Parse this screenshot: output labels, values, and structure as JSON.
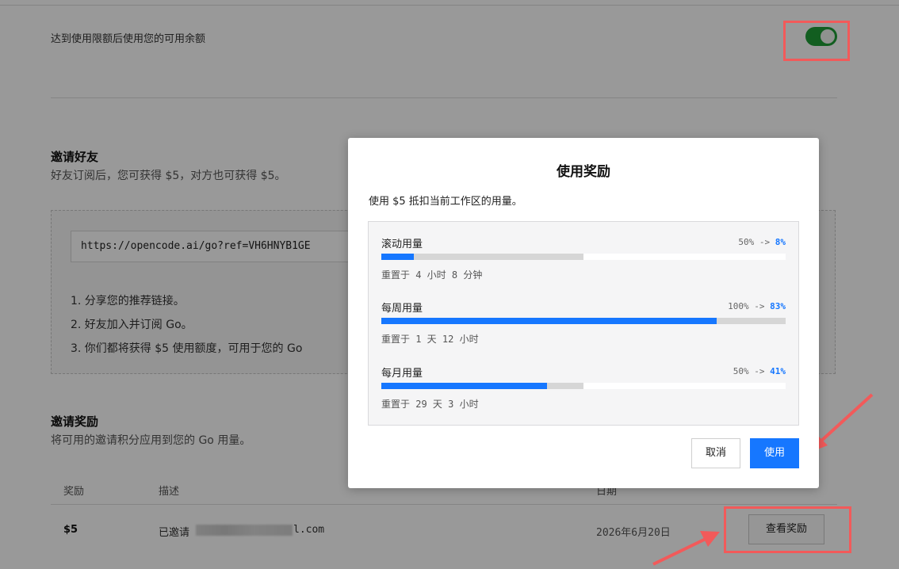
{
  "settings": {
    "balance_toggle_label": "达到使用限额后使用您的可用余额",
    "balance_toggle_on": true
  },
  "invite": {
    "title": "邀请好友",
    "subtitle": "好友订阅后，您可获得 $5，对方也可获得 $5。",
    "ref_link": "https://opencode.ai/go?ref=VH6HNYB1GE",
    "steps": [
      "1. 分享您的推荐链接。",
      "2. 好友加入并订阅 Go。",
      "3. 你们都将获得 $5 使用额度，可用于您的 Go"
    ]
  },
  "rewards": {
    "title": "邀请奖励",
    "subtitle": "将可用的邀请积分应用到您的 Go 用量。",
    "columns": [
      "奖励",
      "描述",
      "日期"
    ],
    "rows": [
      {
        "amount": "$5",
        "desc_prefix": "已邀请",
        "email_suffix": "l.com",
        "date": "2026年6月20日",
        "action": "查看奖励"
      }
    ]
  },
  "modal": {
    "title": "使用奖励",
    "description": "使用 $5 抵扣当前工作区的用量。",
    "usages": [
      {
        "name": "滚动用量",
        "from_label": "50% ->",
        "to_label": "8%",
        "from_pct": 50,
        "to_pct": 8,
        "reset": "重置于 4 小时 8 分钟"
      },
      {
        "name": "每周用量",
        "from_label": "100% ->",
        "to_label": "83%",
        "from_pct": 100,
        "to_pct": 83,
        "reset": "重置于 1 天 12 小时"
      },
      {
        "name": "每月用量",
        "from_label": "50% ->",
        "to_label": "41%",
        "from_pct": 50,
        "to_pct": 41,
        "reset": "重置于 29 天 3 小时"
      }
    ],
    "cancel_label": "取消",
    "apply_label": "使用"
  },
  "colors": {
    "accent": "#1677ff",
    "toggle_on": "#1f9d36",
    "annotation": "#f25a5a"
  }
}
